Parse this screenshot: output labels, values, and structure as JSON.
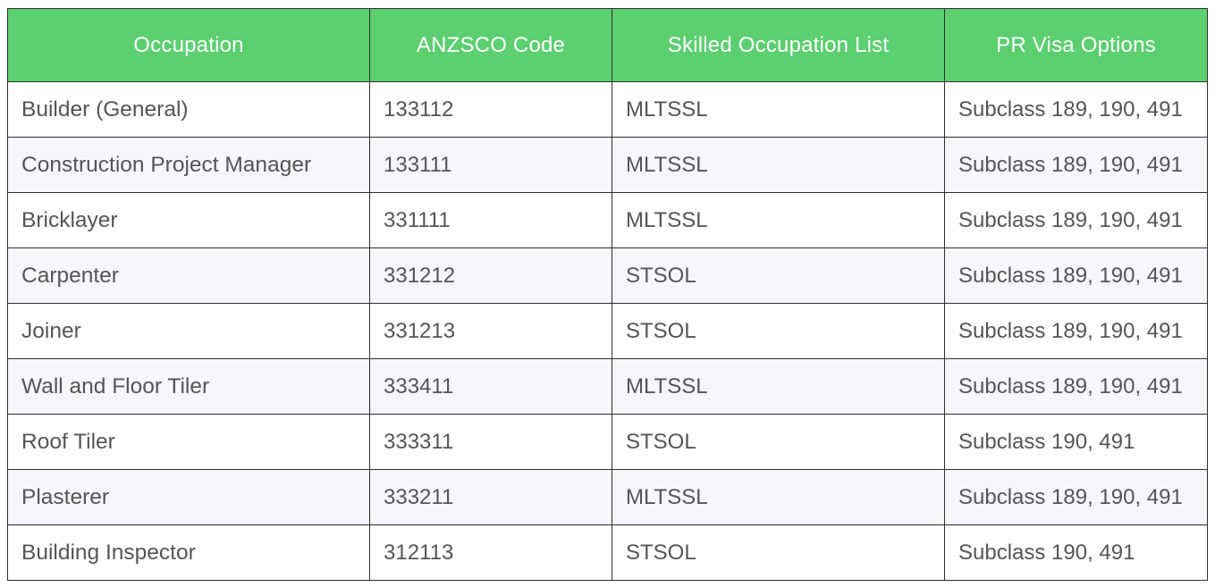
{
  "table": {
    "headers": [
      "Occupation",
      "ANZSCO Code",
      "Skilled Occupation List",
      "PR Visa Options"
    ],
    "rows": [
      [
        "Builder (General)",
        "133112",
        "MLTSSL",
        "Subclass 189, 190, 491"
      ],
      [
        "Construction Project Manager",
        "133111",
        "MLTSSL",
        "Subclass 189, 190, 491"
      ],
      [
        "Bricklayer",
        "331111",
        "MLTSSL",
        "Subclass 189, 190, 491"
      ],
      [
        "Carpenter",
        "331212",
        "STSOL",
        "Subclass 189, 190, 491"
      ],
      [
        "Joiner",
        "331213",
        "STSOL",
        "Subclass 189, 190, 491"
      ],
      [
        "Wall and Floor Tiler",
        "333411",
        "MLTSSL",
        "Subclass 189, 190, 491"
      ],
      [
        "Roof Tiler",
        "333311",
        "STSOL",
        "Subclass 190, 491"
      ],
      [
        "Plasterer",
        "333211",
        "MLTSSL",
        "Subclass 189, 190, 491"
      ],
      [
        "Building Inspector",
        "312113",
        "STSOL",
        "Subclass 190, 491"
      ]
    ]
  },
  "colors": {
    "header_bg": "#5ccf70",
    "header_text": "#ffffff",
    "row_alt_bg": "#f6f6fd",
    "cell_text": "#555555",
    "border": "#2f2f2f"
  }
}
